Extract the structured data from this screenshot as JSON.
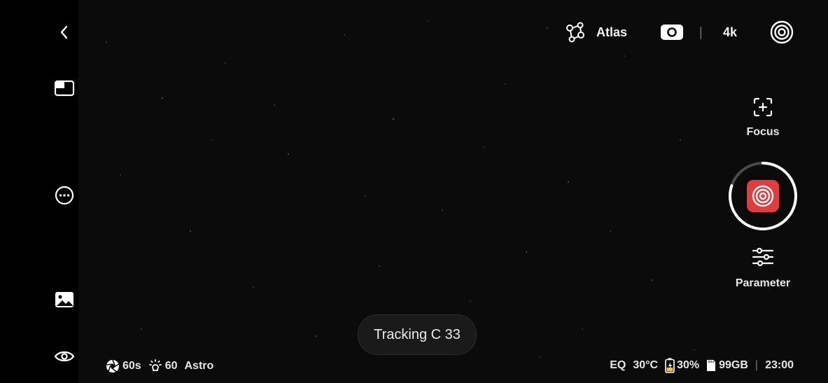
{
  "top_bar": {
    "atlas_label": "Atlas",
    "resolution": "4k",
    "separator": "|"
  },
  "right_panel": {
    "focus_label": "Focus",
    "parameter_label": "Parameter",
    "record_progress_fraction": 0.8
  },
  "tracking": {
    "label": "Tracking C 33"
  },
  "bottom_left": {
    "exposure": "60s",
    "gain": "60",
    "mode": "Astro"
  },
  "bottom_right": {
    "mount": "EQ",
    "temperature": "30°C",
    "battery": "30%",
    "storage": "99GB",
    "separator": "|",
    "time": "23:00"
  },
  "colors": {
    "record_red": "#e23c3c",
    "background": "#0b0b0b"
  },
  "icons": {
    "back": "chevron-left-icon",
    "layout": "picture-in-picture-icon",
    "more": "more-icon",
    "gallery": "image-icon",
    "view": "eye-icon",
    "atlas": "molecule-icon",
    "camera_toggle": "camera-toggle-icon",
    "target": "target-icon",
    "focus": "focus-icon",
    "shutter": "shutter-icon",
    "parameter": "sliders-icon",
    "exposure": "aperture-icon",
    "gain": "sun-icon",
    "battery": "battery-icon",
    "sd": "sd-card-icon"
  }
}
